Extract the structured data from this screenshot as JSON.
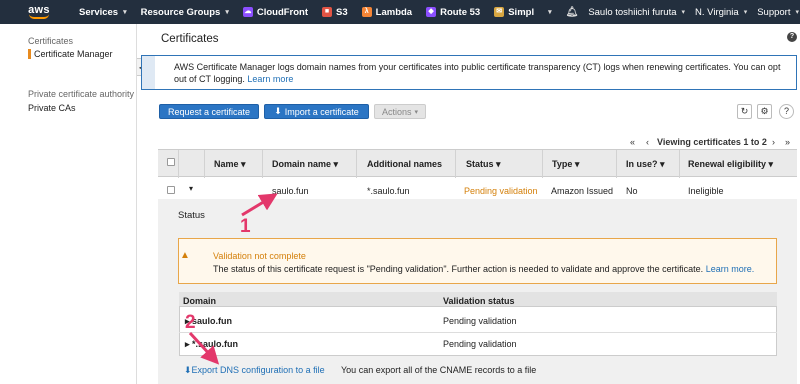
{
  "nav": {
    "logo": "aws",
    "items": [
      {
        "label": "Services",
        "caret": true
      },
      {
        "label": "Resource Groups",
        "caret": true
      },
      {
        "label": "CloudFront",
        "icon": "cloudfront-icon",
        "color": "#8c4fff"
      },
      {
        "label": "S3",
        "icon": "s3-icon",
        "color": "#e25444"
      },
      {
        "label": "Lambda",
        "icon": "lambda-icon",
        "color": "#f58536"
      },
      {
        "label": "Route 53",
        "icon": "route53-icon",
        "color": "#8c4fff"
      },
      {
        "label": "Simpl",
        "icon": "ses-icon",
        "color": "#d9a741"
      }
    ],
    "user": "Saulo toshiichi furuta",
    "region": "N. Virginia",
    "support": "Support"
  },
  "sidebar": {
    "section1_title": "Certificates",
    "item_certificate_manager": "Certificate Manager",
    "section2_title": "Private certificate authority",
    "item_private_cas": "Private CAs"
  },
  "main": {
    "title": "Certificates",
    "info_text": "AWS Certificate Manager logs domain names from your certificates into public certificate transparency (CT) logs when renewing certificates. You can opt out of CT logging.",
    "info_link": "Learn more",
    "request_button": "Request a certificate",
    "import_button": "Import a certificate",
    "actions_button": "Actions",
    "pager_text": "Viewing certificates 1 to 2"
  },
  "table": {
    "columns": [
      "Name",
      "Domain name",
      "Additional names",
      "Status",
      "Type",
      "In use?",
      "Renewal eligibility"
    ],
    "row": {
      "name": "",
      "domain": "saulo.fun",
      "additional": "*.saulo.fun",
      "status": "Pending validation",
      "type": "Amazon Issued",
      "in_use": "No",
      "renewal": "Ineligible"
    }
  },
  "detail": {
    "status_label": "Status",
    "warn_title": "Validation not complete",
    "warn_text": "The status of this certificate request is \"Pending validation\". Further action is needed to validate and approve the certificate.",
    "warn_link": "Learn more.",
    "domain_header": "Domain",
    "validation_header": "Validation status",
    "domains": [
      {
        "domain": "saulo.fun",
        "status": "Pending validation"
      },
      {
        "domain": "*.saulo.fun",
        "status": "Pending validation"
      }
    ],
    "export_link": "Export DNS configuration to a file",
    "export_note": "You can export all of the CNAME records to a file"
  },
  "annotations": [
    "1",
    "2"
  ],
  "colors": {
    "accent": "#e3386b",
    "pending": "#d4800b",
    "primary": "#2b75c4"
  }
}
